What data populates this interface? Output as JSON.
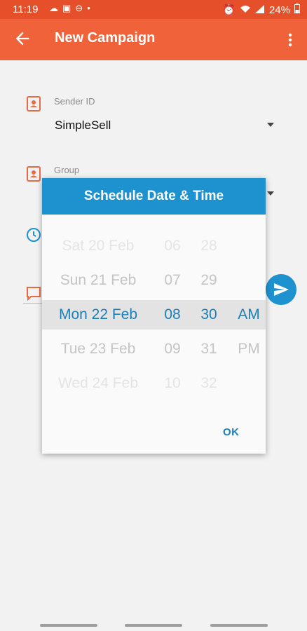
{
  "status_bar": {
    "time": "11:19",
    "battery": "24%"
  },
  "app_bar": {
    "title": "New Campaign"
  },
  "form": {
    "sender": {
      "label": "Sender ID",
      "value": "SimpleSell"
    },
    "group": {
      "label": "Group"
    }
  },
  "dialog": {
    "title": "Schedule Date & Time",
    "dates": [
      "Sat 20 Feb",
      "Sun 21 Feb",
      "Mon 22 Feb",
      "Tue 23 Feb",
      "Wed 24 Feb"
    ],
    "hours": [
      "06",
      "07",
      "08",
      "09",
      "10"
    ],
    "minutes": [
      "28",
      "29",
      "30",
      "31",
      "32"
    ],
    "ampm": [
      "AM",
      "PM"
    ],
    "selected": {
      "date": "Mon 22 Feb",
      "hour": "08",
      "minute": "30",
      "ampm": "AM"
    },
    "ok_label": "OK"
  },
  "colors": {
    "status_bar": "#e5502a",
    "app_bar": "#f0633a",
    "accent_blue": "#1d92cf",
    "icon_orange": "#e96a43"
  }
}
